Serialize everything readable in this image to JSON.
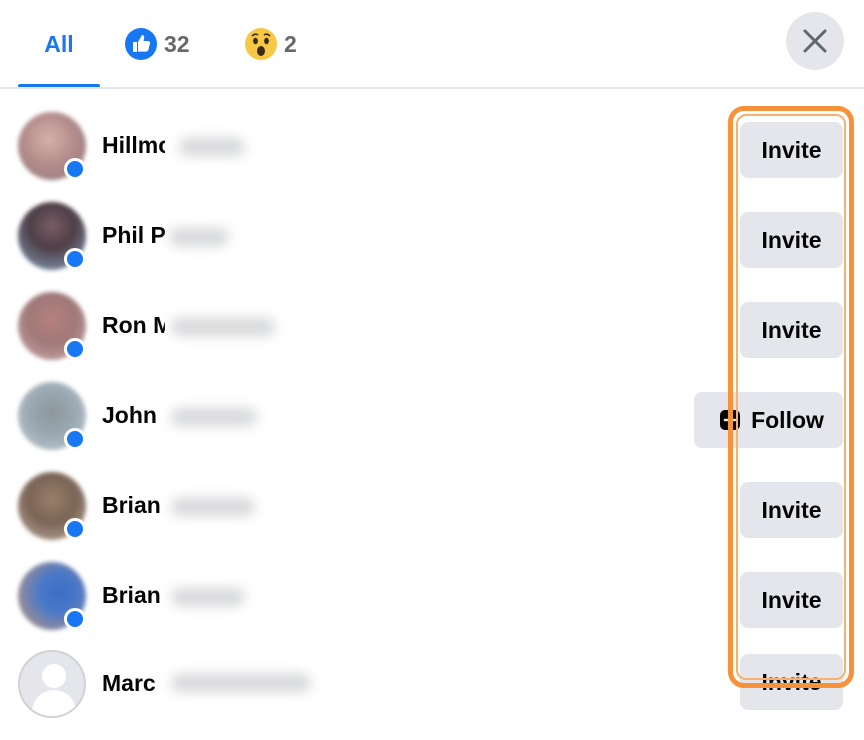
{
  "tabs": [
    {
      "label": "All",
      "active": true
    },
    {
      "reaction": "like-icon",
      "count": "32"
    },
    {
      "reaction": "wow-emoji-icon",
      "count": "2"
    }
  ],
  "close": {
    "icon": "close-icon"
  },
  "people": [
    {
      "name": "Hillmo",
      "action": "Invite",
      "avatar_color": "#b48c8c"
    },
    {
      "name": "Phil P",
      "action": "Invite",
      "avatar_color": "#5a4a52"
    },
    {
      "name": "Ron M",
      "action": "Invite",
      "avatar_color": "#a07878"
    },
    {
      "name": "John",
      "action": "Follow",
      "avatar_color": "#9aa8b2"
    },
    {
      "name": "Brian",
      "action": "Invite",
      "avatar_color": "#7a6456"
    },
    {
      "name": "Brian",
      "action": "Invite",
      "avatar_color": "#4a78c8"
    },
    {
      "name": "Marc",
      "action": "Invite",
      "avatar_color": "#d4d6d8"
    }
  ],
  "colors": {
    "accent": "#1877f2",
    "highlight": "#f7923a"
  }
}
